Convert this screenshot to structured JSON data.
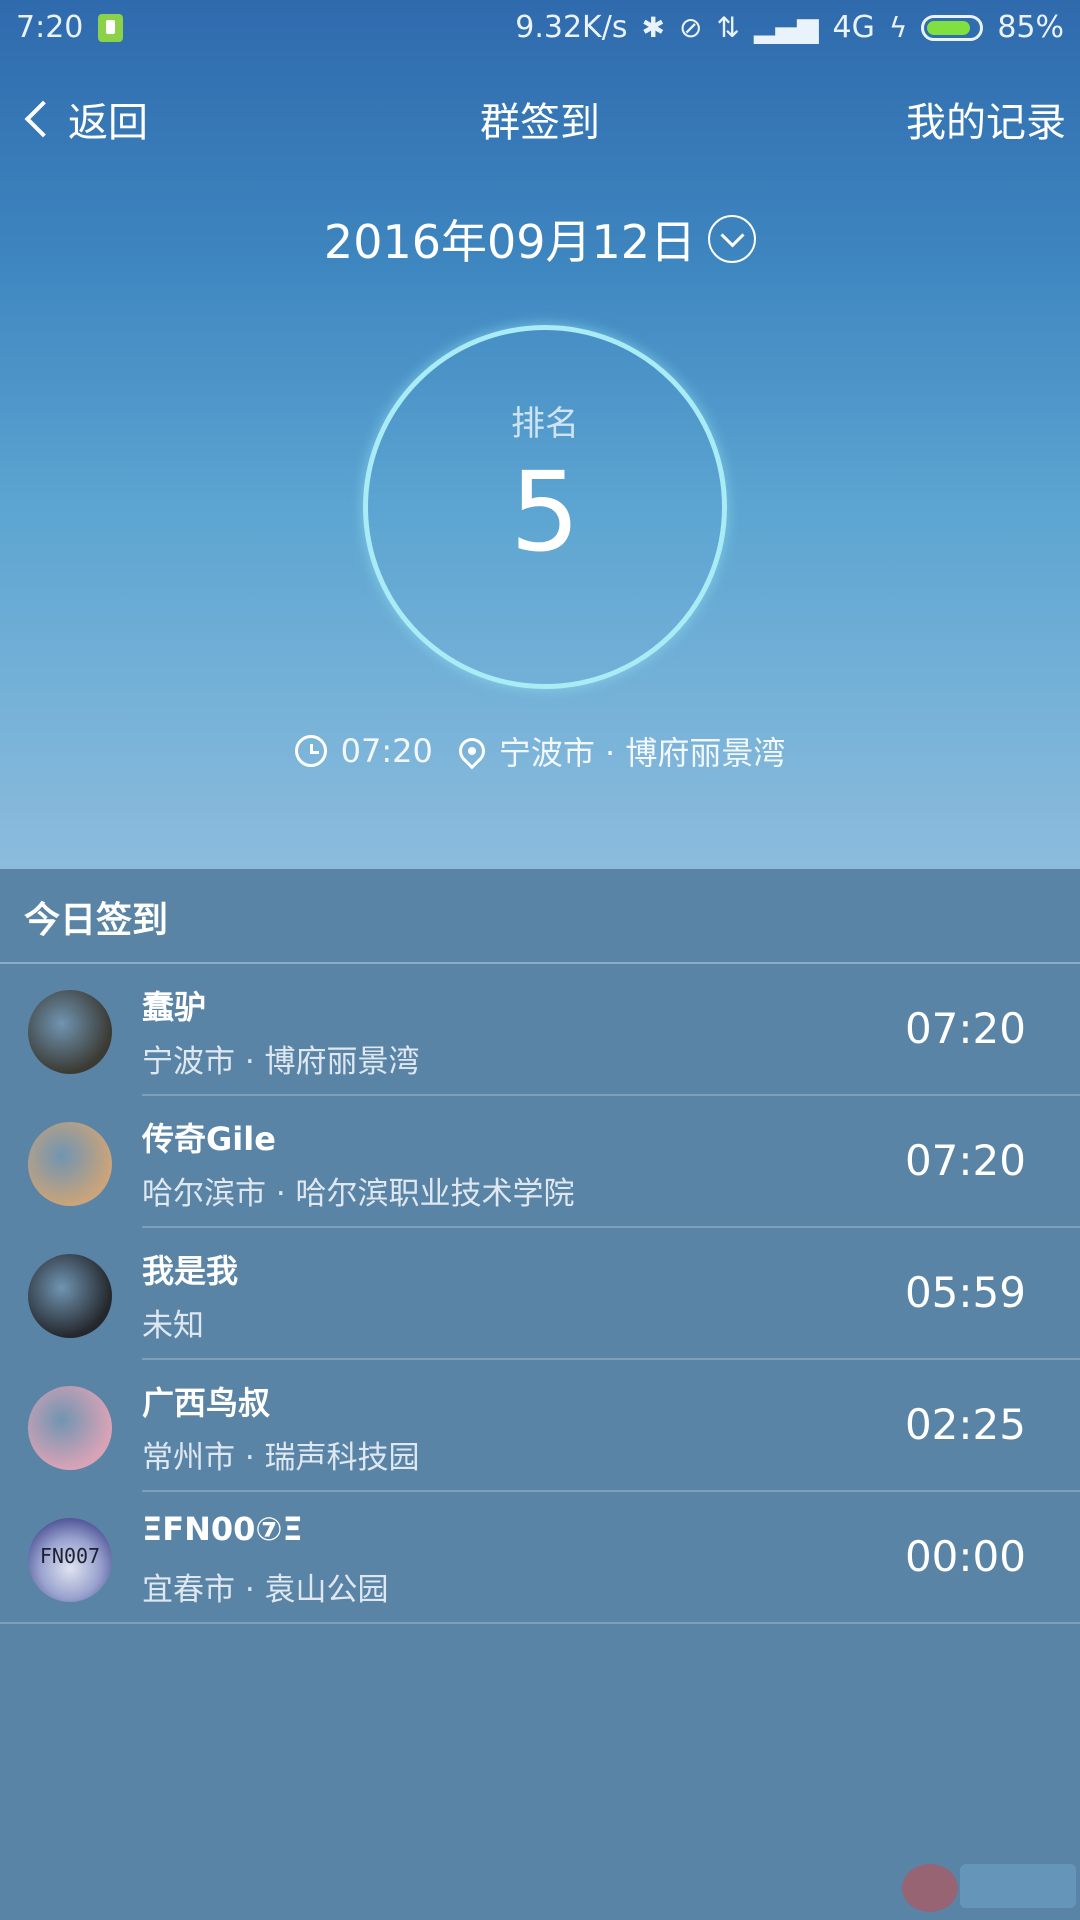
{
  "status_bar": {
    "time": "7:20",
    "network_speed": "9.32K/s",
    "network_type": "4G",
    "battery_percent": "85%",
    "battery_level": 0.85,
    "icons": [
      "bluetooth-icon",
      "mute-icon",
      "data-arrows-icon",
      "signal-icon",
      "charging-icon"
    ]
  },
  "nav": {
    "back_label": "返回",
    "title": "群签到",
    "records_label": "我的记录"
  },
  "date": "2016年09月12日",
  "rank": {
    "label": "排名",
    "value": "5"
  },
  "checkin": {
    "time": "07:20",
    "location": "宁波市 · 博府丽景湾"
  },
  "today": {
    "title": "今日签到",
    "entries": [
      {
        "name": "蠢驴",
        "place": "宁波市 · 博府丽景湾",
        "time": "07:20",
        "avatar_color": "#3b3a33"
      },
      {
        "name": "传奇Gile",
        "place": "哈尔滨市 · 哈尔滨职业技术学院",
        "time": "07:20",
        "avatar_color": "#caa47a"
      },
      {
        "name": "我是我",
        "place": "未知",
        "time": "05:59",
        "avatar_color": "#24272c"
      },
      {
        "name": "广西鸟叔",
        "place": "常州市 · 瑞声科技园",
        "time": "02:25",
        "avatar_color": "#d9a3b6"
      },
      {
        "name": "ΞFN00⑦Ξ",
        "place": "宜春市 · 袁山公园",
        "time": "00:00",
        "avatar_color": "#4a4f93",
        "avatar_text": "FN007"
      }
    ]
  },
  "colors": {
    "hero_top": "#2f6aad",
    "hero_bottom": "#8cbcdd",
    "panel_bg": "#5a84a6",
    "ring": "#a9ecf5"
  }
}
